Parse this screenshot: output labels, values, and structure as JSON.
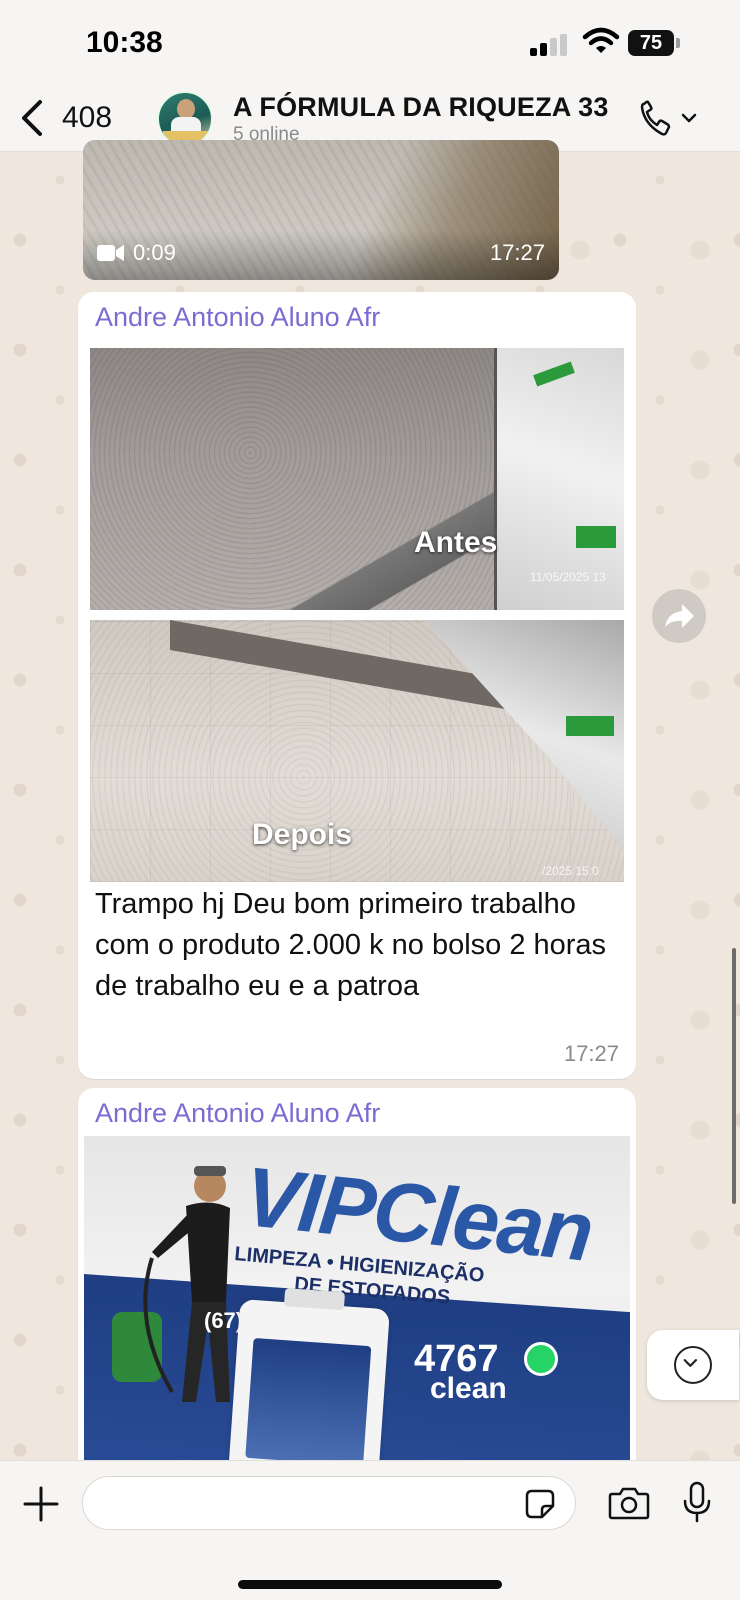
{
  "status_bar": {
    "time": "10:38",
    "battery": "75"
  },
  "header": {
    "back_count": "408",
    "group_title": "A FÓRMULA DA RIQUEZA 33",
    "subtitle": "5 online",
    "icons": [
      "chevron-left-icon",
      "phone-icon",
      "chevron-down-icon"
    ]
  },
  "messages": [
    {
      "type": "video",
      "duration": "0:09",
      "time": "17:27"
    },
    {
      "type": "photos_text",
      "sender": "Andre Antonio Aluno Afr",
      "photo1_caption": "Antes",
      "photo1_stamp": "11/05/2025 13",
      "photo2_caption": "Depois",
      "photo2_stamp": "/2025 15:0",
      "text": "Trampo hj Deu bom primeiro trabalho com o produto 2.000 k no bolso 2 horas de trabalho eu e a patroa",
      "time": "17:27"
    },
    {
      "type": "photo",
      "sender": "Andre Antonio Aluno Afr",
      "photo_brand": "VIPClean",
      "photo_line1": "LIMPEZA • HIGIENIZAÇÃO",
      "photo_line2": "DE ESTOFADOS",
      "photo_phone_prefix": "(67) 9",
      "photo_phone_suffix": "4767",
      "photo_web": "clean"
    }
  ],
  "input": {
    "placeholder": "",
    "icons": [
      "plus-icon",
      "sticker-icon",
      "camera-icon",
      "mic-icon"
    ]
  },
  "colors": {
    "sender_name": "#7b6cd1",
    "wallpaper": "#efe7de",
    "bubble": "#ffffff"
  }
}
